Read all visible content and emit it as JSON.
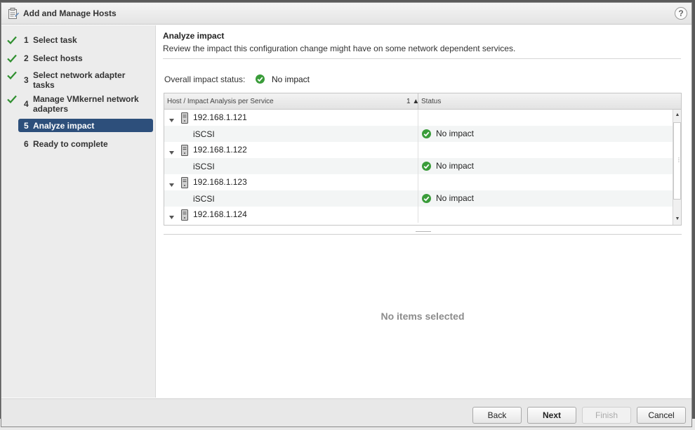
{
  "dialog": {
    "title": "Add and Manage Hosts",
    "help_label": "?"
  },
  "steps": [
    {
      "num": "1",
      "label": "Select task",
      "completed": true,
      "active": false
    },
    {
      "num": "2",
      "label": "Select hosts",
      "completed": true,
      "active": false
    },
    {
      "num": "3",
      "label": "Select network adapter tasks",
      "completed": true,
      "active": false
    },
    {
      "num": "4",
      "label": "Manage VMkernel network adapters",
      "completed": true,
      "active": false
    },
    {
      "num": "5",
      "label": "Analyze impact",
      "completed": false,
      "active": true
    },
    {
      "num": "6",
      "label": "Ready to complete",
      "completed": false,
      "active": false
    }
  ],
  "page": {
    "title": "Analyze impact",
    "description": "Review the impact this configuration change might have on some network dependent services.",
    "overall_label": "Overall impact status:",
    "overall_value": "No impact"
  },
  "table": {
    "col1_header": "Host / Impact Analysis per Service",
    "sort_indicator": "1 ▲",
    "col2_header": "Status",
    "rows": [
      {
        "type": "host",
        "label": "192.168.1.121",
        "status": ""
      },
      {
        "type": "service",
        "label": "iSCSI",
        "status": "No impact"
      },
      {
        "type": "host",
        "label": "192.168.1.122",
        "status": ""
      },
      {
        "type": "service",
        "label": "iSCSI",
        "status": "No impact"
      },
      {
        "type": "host",
        "label": "192.168.1.123",
        "status": ""
      },
      {
        "type": "service",
        "label": "iSCSI",
        "status": "No impact"
      },
      {
        "type": "host",
        "label": "192.168.1.124",
        "status": ""
      }
    ]
  },
  "details": {
    "empty_message": "No items selected"
  },
  "buttons": {
    "back": "Back",
    "next": "Next",
    "finish": "Finish",
    "cancel": "Cancel"
  },
  "colors": {
    "active_step_bg": "#2d4f7b",
    "success_green": "#3a9c3a",
    "check_green": "#2f8f2f"
  },
  "icons": {
    "title": "wizard-clipboard-icon",
    "completed_step": "checkmark-icon",
    "host": "server-host-icon",
    "status_ok": "green-check-circle-icon",
    "expand": "caret-down-icon"
  }
}
